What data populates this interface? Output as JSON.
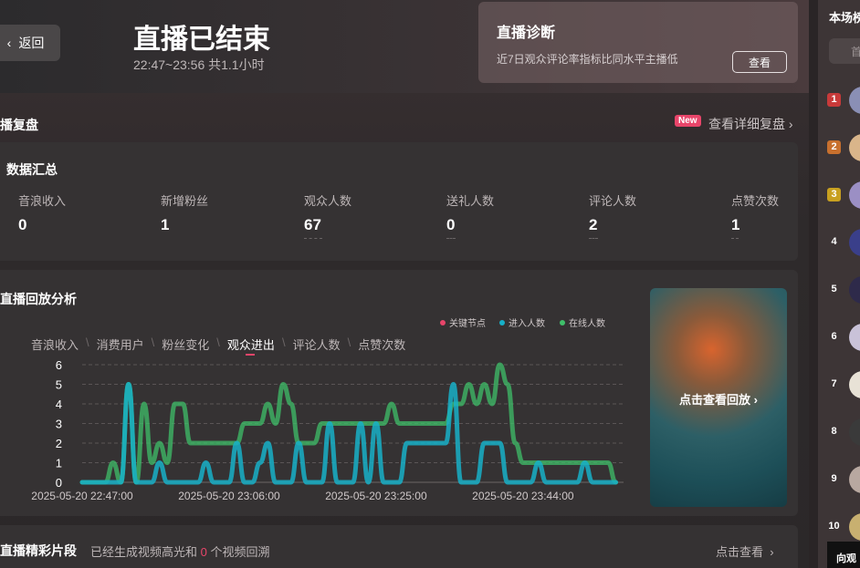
{
  "header": {
    "back_label": "返回",
    "title": "直播已结束",
    "time_range": "22:47~23:56 共1.1小时"
  },
  "diagnosis": {
    "title": "直播诊断",
    "desc": "近7日观众评论率指标比同水平主播低",
    "button": "查看"
  },
  "review": {
    "title": "播复盘",
    "badge": "New",
    "link": "查看详细复盘"
  },
  "summary": {
    "title": "数据汇总",
    "metrics": [
      {
        "label": "音浪收入",
        "value": "0"
      },
      {
        "label": "新增粉丝",
        "value": "1"
      },
      {
        "label": "观众人数",
        "value": "67"
      },
      {
        "label": "送礼人数",
        "value": "0"
      },
      {
        "label": "评论人数",
        "value": "2"
      },
      {
        "label": "点赞次数",
        "value": "1"
      }
    ]
  },
  "analysis": {
    "title": "直播回放分析",
    "tabs": [
      "音浪收入",
      "消费用户",
      "粉丝变化",
      "观众进出",
      "评论人数",
      "点赞次数"
    ],
    "active_tab": 3,
    "legend": [
      {
        "label": "关键节点",
        "color": "#e8456a"
      },
      {
        "label": "进入人数",
        "color": "#17b0c8"
      },
      {
        "label": "在线人数",
        "color": "#3fbf6a"
      }
    ]
  },
  "replay": {
    "label": "点击查看回放"
  },
  "clips": {
    "title": "直播精彩片段",
    "desc_prefix": "已经生成视频高光和",
    "count": "0",
    "desc_suffix": "个视频回溯",
    "link": "点击查看"
  },
  "right_panel": {
    "title": "本场榜",
    "search_placeholder": "首",
    "ranks": [
      "1",
      "2",
      "3",
      "4",
      "5",
      "6",
      "7",
      "8",
      "9",
      "10"
    ],
    "bottom_label": "向观"
  },
  "chart_data": {
    "type": "line",
    "ylim": [
      0,
      6
    ],
    "y_ticks": [
      0,
      1,
      2,
      3,
      4,
      5,
      6
    ],
    "x_tick_labels": [
      "2025-05-20 22:47:00",
      "2025-05-20 23:06:00",
      "2025-05-20 23:25:00",
      "2025-05-20 23:44:00"
    ],
    "x_minutes": [
      0,
      19,
      38,
      57
    ],
    "x_range_minutes": [
      0,
      70
    ],
    "series": [
      {
        "name": "在线人数",
        "color": "#3fbf6a",
        "points": [
          [
            0,
            0
          ],
          [
            3,
            0
          ],
          [
            4,
            1
          ],
          [
            5,
            0
          ],
          [
            6,
            5
          ],
          [
            7,
            0
          ],
          [
            8,
            4
          ],
          [
            9,
            1
          ],
          [
            10,
            2
          ],
          [
            11,
            1
          ],
          [
            12,
            4
          ],
          [
            13,
            4
          ],
          [
            14,
            2
          ],
          [
            16,
            2
          ],
          [
            18,
            2
          ],
          [
            20,
            2
          ],
          [
            21,
            3
          ],
          [
            23,
            3
          ],
          [
            24,
            4
          ],
          [
            25,
            3
          ],
          [
            26,
            5
          ],
          [
            27,
            4
          ],
          [
            28,
            2
          ],
          [
            30,
            2
          ],
          [
            31,
            3
          ],
          [
            39,
            3
          ],
          [
            40,
            4
          ],
          [
            41,
            3
          ],
          [
            47,
            3
          ],
          [
            48,
            4
          ],
          [
            49,
            4
          ],
          [
            50,
            5
          ],
          [
            51,
            4
          ],
          [
            52,
            5
          ],
          [
            53,
            4
          ],
          [
            54,
            6
          ],
          [
            55,
            5
          ],
          [
            56,
            2
          ],
          [
            57,
            1
          ],
          [
            68,
            1
          ],
          [
            69,
            0
          ]
        ]
      },
      {
        "name": "进入人数",
        "color": "#17b0c8",
        "points": [
          [
            0,
            0
          ],
          [
            5,
            0
          ],
          [
            6,
            5
          ],
          [
            7,
            0
          ],
          [
            9,
            0
          ],
          [
            10,
            1
          ],
          [
            11,
            0
          ],
          [
            15,
            0
          ],
          [
            16,
            1
          ],
          [
            17,
            0
          ],
          [
            19,
            0
          ],
          [
            20,
            2
          ],
          [
            21,
            0
          ],
          [
            22,
            0
          ],
          [
            23,
            1
          ],
          [
            24,
            2
          ],
          [
            25,
            0
          ],
          [
            27,
            0
          ],
          [
            28,
            2
          ],
          [
            29,
            0
          ],
          [
            31,
            0
          ],
          [
            32,
            3
          ],
          [
            33,
            0
          ],
          [
            35,
            0
          ],
          [
            36,
            3
          ],
          [
            37,
            0
          ],
          [
            38,
            3
          ],
          [
            39,
            0
          ],
          [
            41,
            0
          ],
          [
            42,
            2
          ],
          [
            47,
            2
          ],
          [
            48,
            5
          ],
          [
            49,
            0
          ],
          [
            51,
            0
          ],
          [
            52,
            2
          ],
          [
            54,
            2
          ],
          [
            55,
            0
          ],
          [
            58,
            0
          ],
          [
            59,
            1
          ],
          [
            60,
            0
          ],
          [
            64,
            0
          ],
          [
            65,
            1
          ],
          [
            66,
            0
          ],
          [
            69,
            0
          ]
        ]
      }
    ],
    "grid": true
  }
}
